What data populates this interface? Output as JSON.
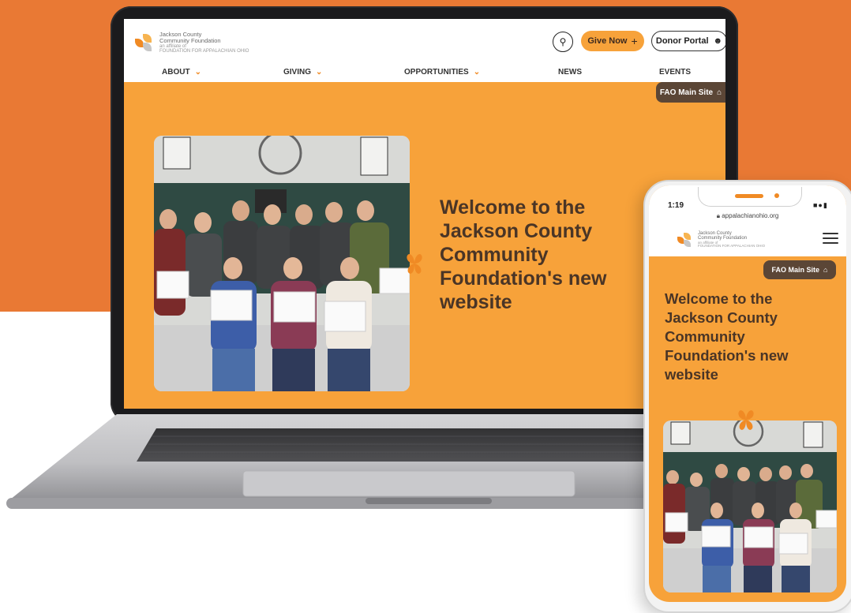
{
  "site": {
    "logo_line1": "Jackson County",
    "logo_line2": "Community Foundation",
    "logo_line3": "an affiliate of",
    "logo_line4": "FOUNDATION FOR APPALACHIAN OHIO"
  },
  "header": {
    "give_label": "Give Now",
    "donor_label": "Donor Portal",
    "fao_label": "FAO Main Site"
  },
  "nav": {
    "items": [
      "ABOUT",
      "GIVING",
      "OPPORTUNITIES",
      "NEWS",
      "EVENTS"
    ]
  },
  "hero": {
    "title": "Welcome to the Jackson County Community Foundation's new website"
  },
  "phone": {
    "time": "1:19",
    "url": "appalachianohio.org",
    "fao_label": "FAO Main Site",
    "title": "Welcome to the Jackson County Community Foundation's new website"
  },
  "colors": {
    "background": "#e97934",
    "accent": "#f7a23a",
    "brown": "#5b4636",
    "title": "#4a3526"
  }
}
